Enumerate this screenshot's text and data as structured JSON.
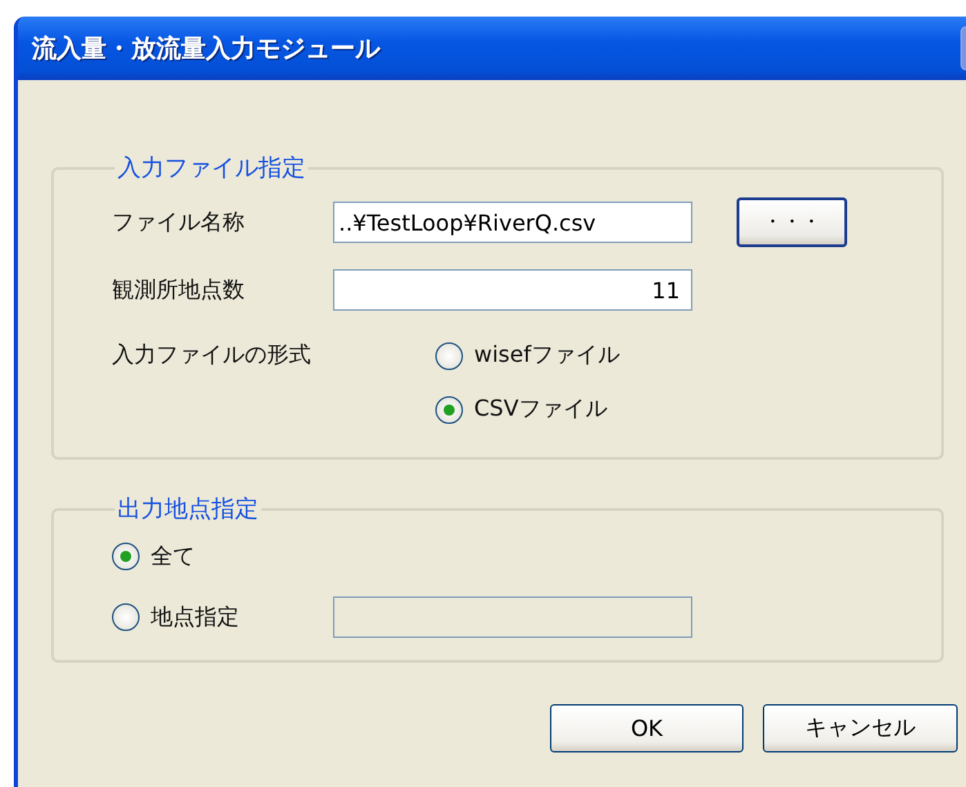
{
  "window": {
    "title": "流入量・放流量入力モジュール"
  },
  "input_group": {
    "legend": "入力ファイル指定",
    "file_name": {
      "label": "ファイル名称",
      "value": "..¥TestLoop¥RiverQ.csv"
    },
    "browse_button": {
      "label": "・・・",
      "focused": true
    },
    "station_count": {
      "label": "観測所地点数",
      "value": "11"
    },
    "format": {
      "label": "入力ファイルの形式",
      "options": [
        {
          "label": "wisefファイル",
          "selected": false
        },
        {
          "label": "CSVファイル",
          "selected": true
        }
      ]
    }
  },
  "output_group": {
    "legend": "出力地点指定",
    "options": [
      {
        "kind": "plain",
        "label": "全て",
        "selected": true
      },
      {
        "kind": "with_field",
        "label": "地点指定",
        "selected": false,
        "field_disabled": true
      }
    ]
  },
  "buttons": [
    "OK",
    "キャンセル"
  ]
}
